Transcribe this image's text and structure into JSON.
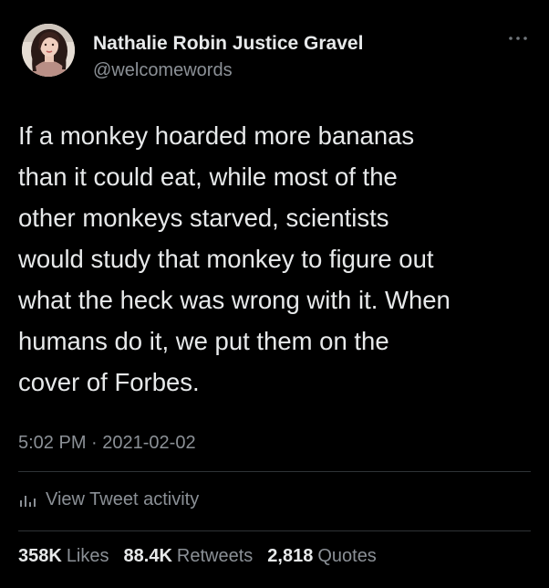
{
  "author": {
    "display_name": "Nathalie Robin Justice Gravel",
    "handle": "@welcomewords",
    "avatar_icon": "profile-photo"
  },
  "tweet": {
    "text": "If a monkey hoarded more bananas\nthan it could eat, while most of the\nother monkeys starved, scientists\nwould study that monkey to figure out\nwhat the heck was wrong with it. When\nhumans do it, we put them on the\ncover of Forbes.",
    "time": "5:02 PM",
    "separator": "·",
    "date": "2021-02-02"
  },
  "activity": {
    "label": "View Tweet activity",
    "icon": "bar-chart-icon"
  },
  "stats": [
    {
      "count": "358K",
      "label": "Likes"
    },
    {
      "count": "88.4K",
      "label": "Retweets"
    },
    {
      "count": "2,818",
      "label": "Quotes"
    }
  ],
  "more_icon": "more-icon",
  "colors": {
    "background": "#000000",
    "primary_text": "#e7e9ea",
    "secondary_text": "#8b9096",
    "divider": "#2f3336"
  }
}
